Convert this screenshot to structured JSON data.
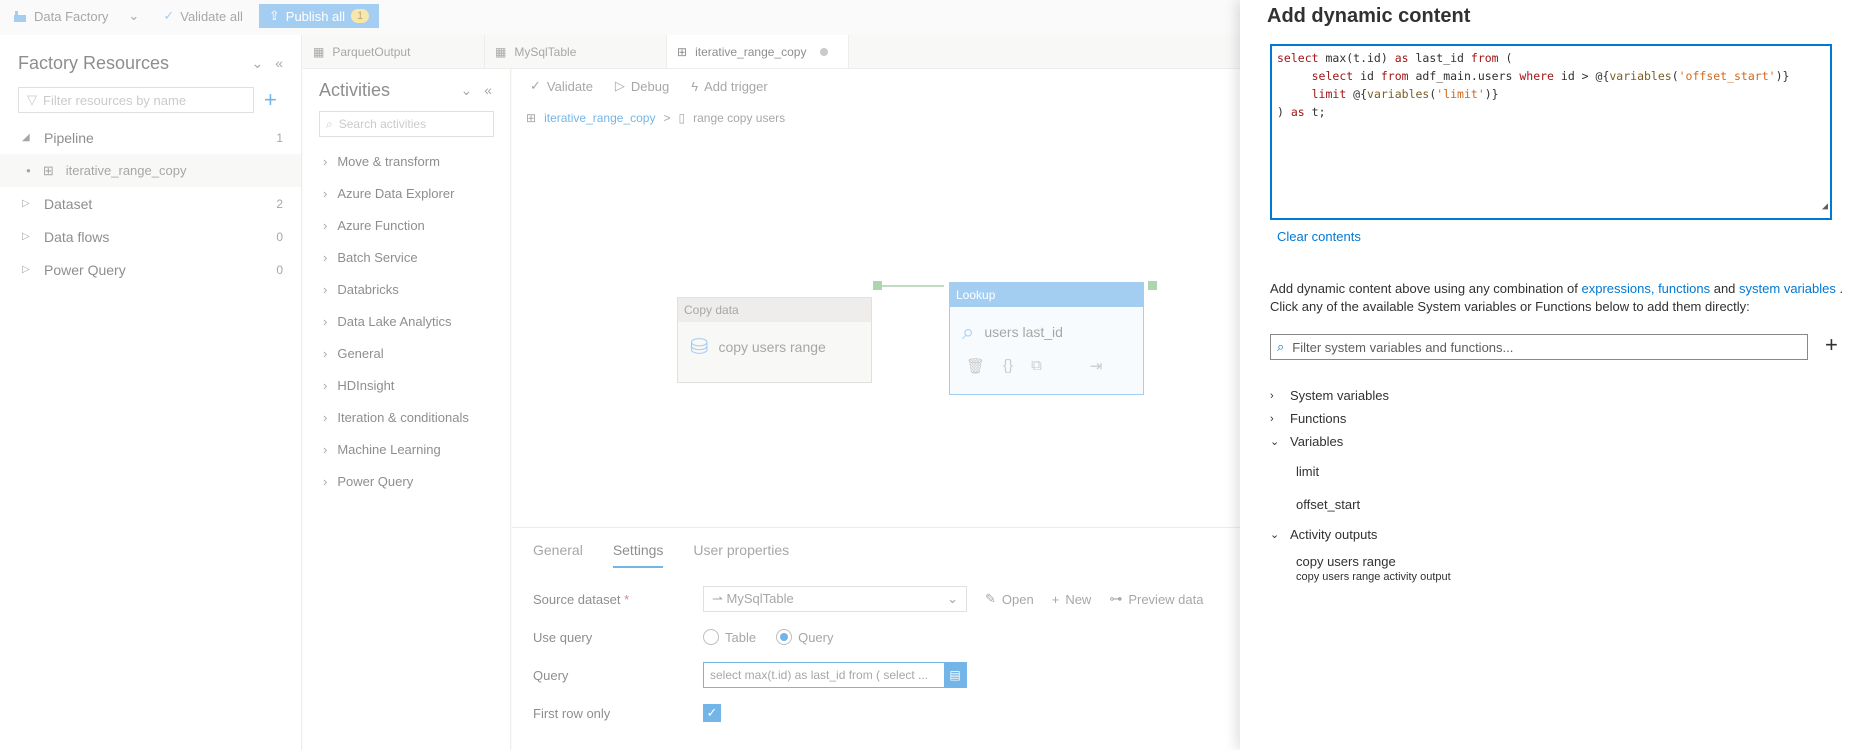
{
  "topbar": {
    "factory_label": "Data Factory",
    "validate_all": "Validate all",
    "publish_all": "Publish all",
    "publish_count": "1"
  },
  "resources": {
    "title": "Factory Resources",
    "filter_placeholder": "Filter resources by name",
    "items": [
      {
        "label": "Pipeline",
        "count": "1"
      },
      {
        "label": "Dataset",
        "count": "2"
      },
      {
        "label": "Data flows",
        "count": "0"
      },
      {
        "label": "Power Query",
        "count": "0"
      }
    ],
    "pipeline_child": "iterative_range_copy"
  },
  "tabs": [
    {
      "label": "ParquetOutput"
    },
    {
      "label": "MySqlTable"
    },
    {
      "label": "iterative_range_copy"
    }
  ],
  "activities": {
    "title": "Activities",
    "search_placeholder": "Search activities",
    "items": [
      "Move & transform",
      "Azure Data Explorer",
      "Azure Function",
      "Batch Service",
      "Databricks",
      "Data Lake Analytics",
      "General",
      "HDInsight",
      "Iteration & conditionals",
      "Machine Learning",
      "Power Query"
    ]
  },
  "canvas": {
    "validate": "Validate",
    "debug": "Debug",
    "add_trigger": "Add trigger",
    "breadcrumb_pipeline": "iterative_range_copy",
    "breadcrumb_sep": ">",
    "breadcrumb_activity": "range copy users",
    "copy_node": {
      "header": "Copy data",
      "label": "copy users range"
    },
    "lookup_node": {
      "header": "Lookup",
      "label": "users last_id"
    }
  },
  "props": {
    "tabs": [
      "General",
      "Settings",
      "User properties"
    ],
    "source_dataset_label": "Source dataset",
    "source_dataset_value": "MySqlTable",
    "open": "Open",
    "new": "New",
    "preview": "Preview data",
    "use_query_label": "Use query",
    "opt_table": "Table",
    "opt_query": "Query",
    "query_label": "Query",
    "query_value": "select max(t.id) as last_id from ( select ...",
    "first_row_label": "First row only"
  },
  "panel": {
    "title": "Add dynamic content",
    "clear": "Clear contents",
    "help_1": "Add dynamic content above using any combination of ",
    "help_expr": "expressions, functions",
    "help_and": " and ",
    "help_sys": "system variables",
    "help_2": " .",
    "help_3": "Click any of the available System variables or Functions below to add them directly:",
    "filter_placeholder": "Filter system variables and functions...",
    "sections": {
      "system_variables": "System variables",
      "functions": "Functions",
      "variables": "Variables",
      "activity_outputs": "Activity outputs"
    },
    "variables": [
      "limit",
      "offset_start"
    ],
    "output_name": "copy users range",
    "output_sub": "copy users range activity output"
  },
  "colors": {
    "accent": "#0078d4",
    "lookup": "#5aa6e6"
  }
}
